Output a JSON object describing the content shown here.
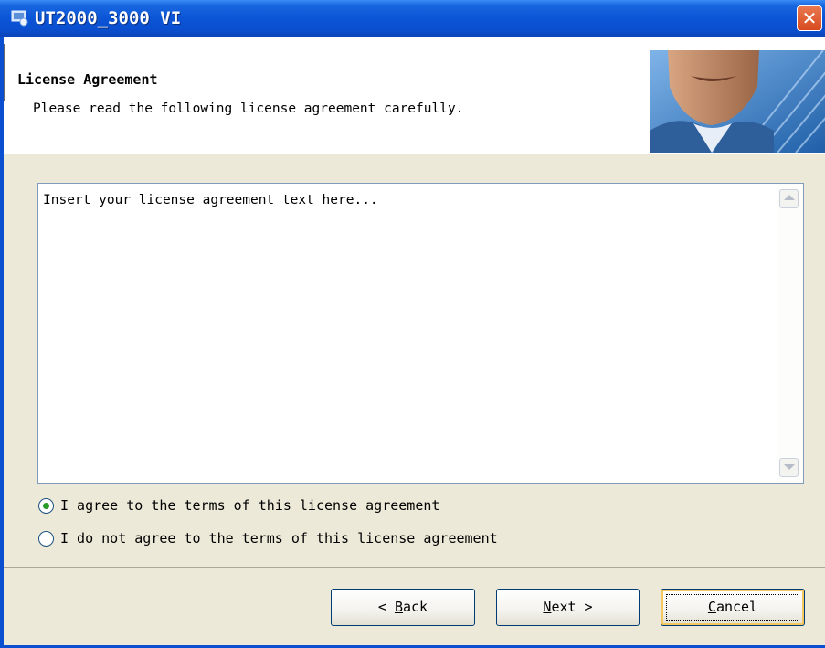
{
  "window": {
    "title": "UT2000_3000 VI"
  },
  "header": {
    "title": "License Agreement",
    "subtitle": "Please read the following license agreement carefully."
  },
  "license": {
    "text": "Insert your license agreement text here..."
  },
  "options": {
    "agree": "I agree to the terms of this license agreement",
    "disagree": "I do not agree to the terms of this license agreement",
    "selected": "agree"
  },
  "buttons": {
    "back_prefix": "< ",
    "back_mnemonic": "B",
    "back_rest": "ack",
    "next_mnemonic": "N",
    "next_rest": "ext >",
    "cancel_mnemonic": "C",
    "cancel_rest": "ancel"
  },
  "colors": {
    "titlebar": "#0a4fd0",
    "dialog_bg": "#ece9d8",
    "close": "#d84a1f"
  },
  "icons": [
    "app-icon",
    "close-icon",
    "scroll-up-icon",
    "scroll-down-icon",
    "header-photo"
  ]
}
